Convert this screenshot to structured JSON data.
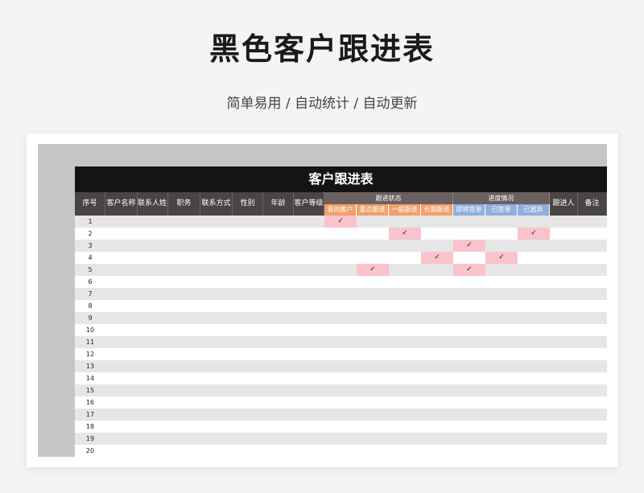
{
  "page": {
    "title": "黑色客户跟进表",
    "subtitle": "简单易用 / 自动统计 / 自动更新"
  },
  "table": {
    "title": "客户跟进表",
    "columns": [
      "序号",
      "客户名称",
      "联系人姓名",
      "职务",
      "联系方式",
      "性别",
      "年龄",
      "客户等级"
    ],
    "group_follow": "跟进状态",
    "group_progress": "进度情况",
    "follow_subs": [
      "意向客户",
      "重点跟进",
      "一般跟进",
      "长期跟进"
    ],
    "progress_subs": [
      "即将签单",
      "已签单",
      "已放弃"
    ],
    "tail_columns": [
      "跟进人",
      "备注"
    ],
    "check_mark": "✓",
    "rows": [
      {
        "no": "1",
        "marks": [
          0
        ]
      },
      {
        "no": "2",
        "marks": [
          2,
          6
        ]
      },
      {
        "no": "3",
        "marks": [
          4
        ]
      },
      {
        "no": "4",
        "marks": [
          3,
          5
        ]
      },
      {
        "no": "5",
        "marks": [
          1,
          4
        ]
      },
      {
        "no": "6",
        "marks": []
      },
      {
        "no": "7",
        "marks": []
      },
      {
        "no": "8",
        "marks": []
      },
      {
        "no": "9",
        "marks": []
      },
      {
        "no": "10",
        "marks": []
      },
      {
        "no": "11",
        "marks": []
      },
      {
        "no": "12",
        "marks": []
      },
      {
        "no": "13",
        "marks": []
      },
      {
        "no": "14",
        "marks": []
      },
      {
        "no": "15",
        "marks": []
      },
      {
        "no": "16",
        "marks": []
      },
      {
        "no": "17",
        "marks": []
      },
      {
        "no": "18",
        "marks": []
      },
      {
        "no": "19",
        "marks": []
      },
      {
        "no": "20",
        "marks": []
      }
    ]
  },
  "colors": {
    "header_dark": "#141414",
    "header_gray": "#4a4444",
    "follow_sub": "#f0a06a",
    "progress_sub": "#8fb0dc",
    "checked_cell": "#f8c3cb"
  }
}
